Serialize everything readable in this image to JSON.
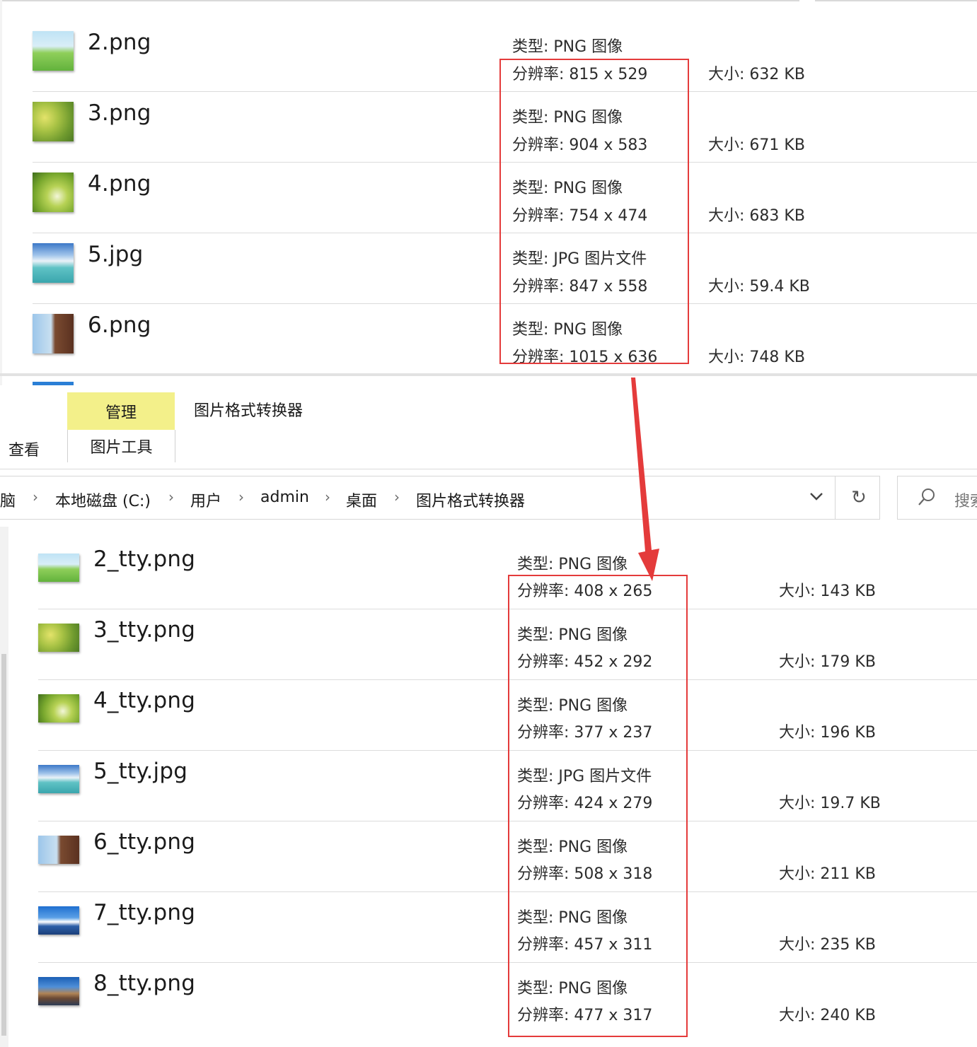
{
  "top_panel": {
    "files": [
      {
        "name": "2.png",
        "type": "类型: PNG 图像",
        "resolution": "分辨率: 815 x 529",
        "size": "大小: 632 KB",
        "thumb": "t-grass"
      },
      {
        "name": "3.png",
        "type": "类型: PNG 图像",
        "resolution": "分辨率: 904 x 583",
        "size": "大小: 671 KB",
        "thumb": "t-yellow"
      },
      {
        "name": "4.png",
        "type": "类型: PNG 图像",
        "resolution": "分辨率: 754 x 474",
        "size": "大小: 683 KB",
        "thumb": "t-daisy"
      },
      {
        "name": "5.jpg",
        "type": "类型: JPG 图片文件",
        "resolution": "分辨率: 847 x 558",
        "size": "大小: 59.4 KB",
        "thumb": "t-sea"
      },
      {
        "name": "6.png",
        "type": "类型: PNG 图像",
        "resolution": "分辨率: 1015 x 636",
        "size": "大小: 748 KB",
        "thumb": "t-rock"
      }
    ]
  },
  "ribbon": {
    "manage_tab": "管理",
    "context_title": "图片格式转换器",
    "view_tab": "查看",
    "picture_tools_tab": "图片工具"
  },
  "address_bar": {
    "crumbs": [
      "脑",
      "本地磁盘 (C:)",
      "用户",
      "admin",
      "桌面",
      "图片格式转换器"
    ],
    "separator": "›",
    "refresh_glyph": "↻"
  },
  "search": {
    "placeholder": "搜索"
  },
  "bottom_panel": {
    "files": [
      {
        "name": "2_tty.png",
        "type": "类型: PNG 图像",
        "resolution": "分辨率: 408 x 265",
        "size": "大小: 143 KB",
        "thumb": "t-grass"
      },
      {
        "name": "3_tty.png",
        "type": "类型: PNG 图像",
        "resolution": "分辨率: 452 x 292",
        "size": "大小: 179 KB",
        "thumb": "t-yellow"
      },
      {
        "name": "4_tty.png",
        "type": "类型: PNG 图像",
        "resolution": "分辨率: 377 x 237",
        "size": "大小: 196 KB",
        "thumb": "t-daisy"
      },
      {
        "name": "5_tty.jpg",
        "type": "类型: JPG 图片文件",
        "resolution": "分辨率: 424 x 279",
        "size": "大小: 19.7 KB",
        "thumb": "t-sea"
      },
      {
        "name": "6_tty.png",
        "type": "类型: PNG 图像",
        "resolution": "分辨率: 508 x 318",
        "size": "大小: 211 KB",
        "thumb": "t-rock"
      },
      {
        "name": "7_tty.png",
        "type": "类型: PNG 图像",
        "resolution": "分辨率: 457 x 311",
        "size": "大小: 235 KB",
        "thumb": "t-coast"
      },
      {
        "name": "8_tty.png",
        "type": "类型: PNG 图像",
        "resolution": "分辨率: 477 x 317",
        "size": "大小: 240 KB",
        "thumb": "t-city"
      }
    ]
  },
  "colors": {
    "annotation_red": "#e43b3b",
    "manage_tab_highlight": "#f3f08a"
  }
}
